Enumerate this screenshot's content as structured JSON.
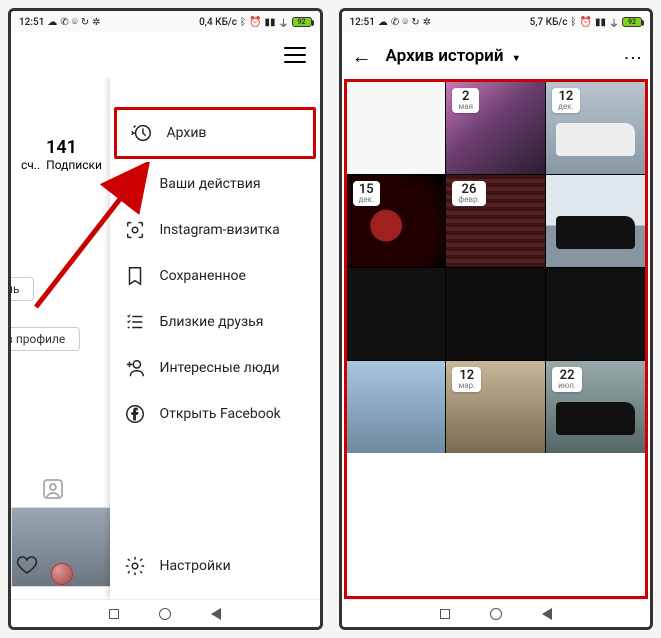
{
  "statusbar": {
    "time": "12:51",
    "data_rate_left": "0,4 КБ/с",
    "data_rate_right": "5,7 КБ/с",
    "battery": "92"
  },
  "left_phone": {
    "stat_number": "141",
    "stat_label_1": "сч..",
    "stat_label_2": "Подписки",
    "pill_1": "ль",
    "pill_2": "в профиле",
    "menu": {
      "archive": "Архив",
      "activity": "Ваши действия",
      "nametag": "Instagram-визитка",
      "saved": "Сохраненное",
      "close_friends": "Близкие друзья",
      "discover": "Интересные люди",
      "facebook": "Открыть Facebook",
      "settings": "Настройки"
    }
  },
  "right_phone": {
    "title": "Архив историй",
    "cells": [
      {
        "day": "",
        "month": ""
      },
      {
        "day": "2",
        "month": "мая"
      },
      {
        "day": "12",
        "month": "дек."
      },
      {
        "day": "15",
        "month": "дек."
      },
      {
        "day": "26",
        "month": "февр."
      },
      {
        "day": "",
        "month": ""
      },
      {
        "day": "",
        "month": ""
      },
      {
        "day": "",
        "month": ""
      },
      {
        "day": "",
        "month": ""
      },
      {
        "day": "",
        "month": ""
      },
      {
        "day": "12",
        "month": "мар."
      },
      {
        "day": "22",
        "month": "июл."
      }
    ]
  }
}
